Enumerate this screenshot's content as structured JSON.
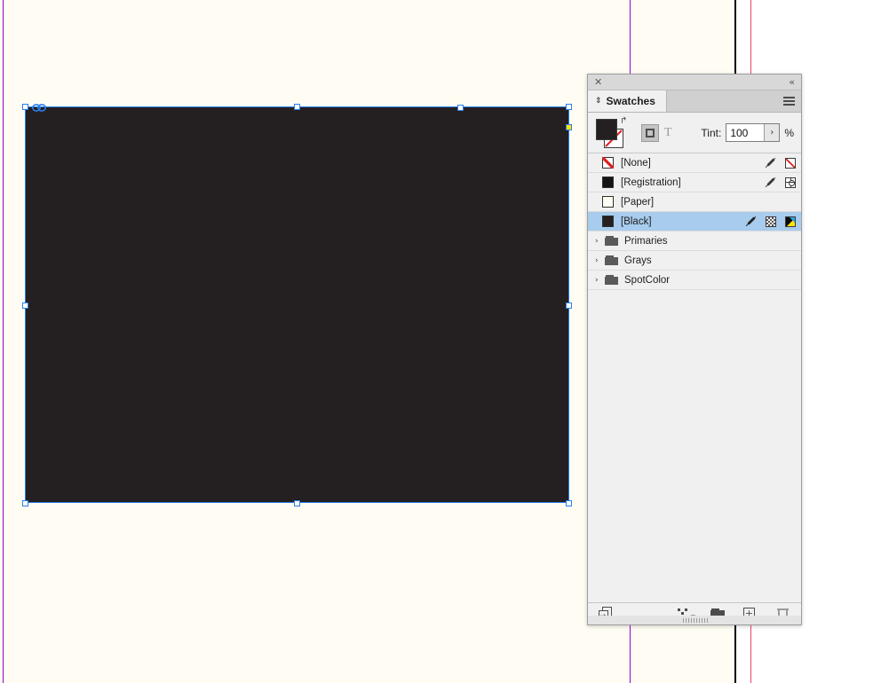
{
  "document": {
    "artboard_background": "#fffdf3",
    "pasteboard_background": "#ffffff",
    "guides": {
      "margin_color": "#9400d3",
      "page_edge_color": "#000000",
      "bleed_color": "#ee4466"
    },
    "selected_object": {
      "name": "rectangle-frame",
      "fill_color": "#242021",
      "selection_color": "#2a7fea",
      "corner_handle_color": "#ffe400"
    }
  },
  "panel": {
    "titlebar": {
      "close_icon": "close-icon",
      "collapse_icon": "«",
      "collapse_label": "collapse-to-icons"
    },
    "tab": {
      "label": "Swatches",
      "grip_glyph": "⇕",
      "menu_label": "panel-menu"
    },
    "controls": {
      "fill_label": "Fill",
      "stroke_label": "Stroke",
      "fill_color": "#242021",
      "stroke_color": "None",
      "swap_glyph": "↱",
      "apply_to_frame_label": "Formatting affects container",
      "apply_to_text_label": "T",
      "tint_label": "Tint:",
      "tint_value": "100",
      "tint_stepper_glyph": "›",
      "tint_unit": "%"
    },
    "swatches": [
      {
        "name": "[None]",
        "chip": "none",
        "icons": [
          "eyedropper-crossed-icon",
          "none-mode-icon"
        ],
        "selected": false
      },
      {
        "name": "[Registration]",
        "chip": "black",
        "icons": [
          "eyedropper-crossed-icon",
          "registration-mode-icon"
        ],
        "selected": false
      },
      {
        "name": "[Paper]",
        "chip": "paper",
        "icons": [],
        "selected": false
      },
      {
        "name": "[Black]",
        "chip": "blackish",
        "icons": [
          "eyedropper-crossed-icon",
          "tint-checker-icon",
          "cmyk-mode-icon"
        ],
        "selected": true
      }
    ],
    "groups": [
      {
        "name": "Primaries",
        "expanded": false,
        "disclosure_glyph": "›"
      },
      {
        "name": "Grays",
        "expanded": false,
        "disclosure_glyph": "›"
      },
      {
        "name": "SpotColor",
        "expanded": false,
        "disclosure_glyph": "›"
      }
    ],
    "footer": {
      "left_button": "show-all-swatches-icon",
      "buttons": [
        "new-color-group-icon",
        "new-swatch-folder-icon",
        "new-swatch-icon",
        "delete-swatch-icon"
      ],
      "plus_glyph": "+"
    }
  }
}
